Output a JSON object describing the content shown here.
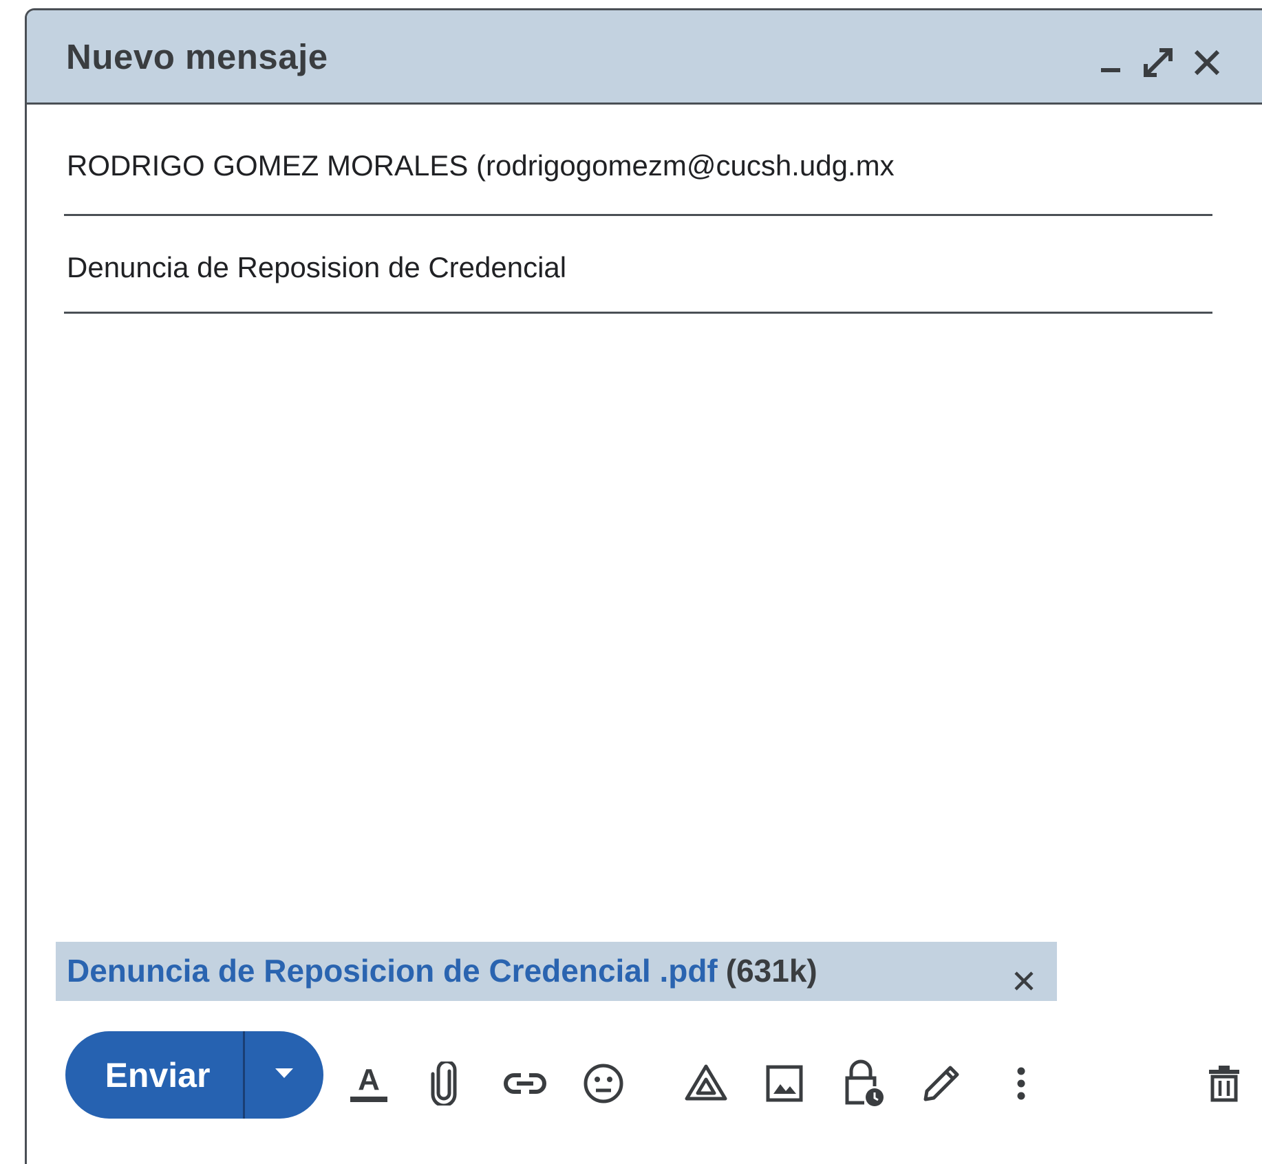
{
  "window": {
    "title": "Nuevo mensaje",
    "header_color": "#c3d2e0"
  },
  "header_buttons": [
    {
      "name": "minimize-icon"
    },
    {
      "name": "expand-icon"
    },
    {
      "name": "close-icon"
    }
  ],
  "fields": {
    "to_value": "RODRIGO GOMEZ MORALES (rodrigogomezm@cucsh.udg.mx",
    "subject_value": "Denuncia de Reposision de Credencial"
  },
  "attachment": {
    "name": "Denuncia de Reposicion de Credencial .pdf",
    "size": "(631k)",
    "link_color": "#2a64b0"
  },
  "toolbar": {
    "send_label": "Enviar",
    "accent": "#2662b1",
    "tools": [
      "text-format-icon",
      "paperclip-icon",
      "link-icon",
      "emoji-icon",
      "drive-icon",
      "image-icon",
      "confidential-lock-icon",
      "signature-pen-icon",
      "more-options-icon",
      "trash-icon"
    ]
  }
}
